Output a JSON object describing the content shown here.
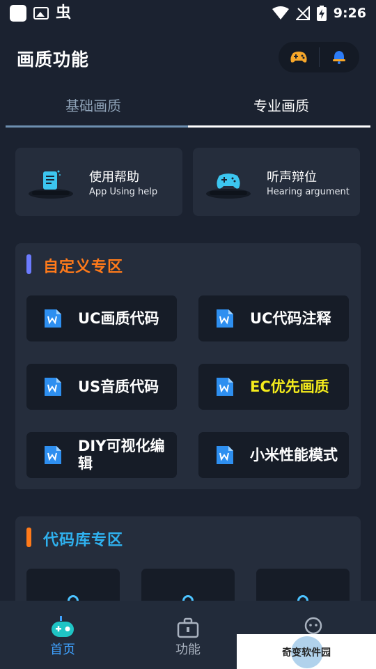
{
  "status_bar": {
    "time": "9:26",
    "bug_glyph": "虫"
  },
  "header": {
    "title": "画质功能",
    "actions": [
      "gamepad-icon",
      "bell-icon"
    ]
  },
  "tabs": [
    {
      "label": "基础画质",
      "active": false
    },
    {
      "label": "专业画质",
      "active": true
    }
  ],
  "help_cards": [
    {
      "title": "使用帮助",
      "subtitle": "App Using help",
      "icon": "document-icon"
    },
    {
      "title": "听声辩位",
      "subtitle": "Hearing argument",
      "icon": "gamepad-icon"
    }
  ],
  "custom_section": {
    "title": "自定义专区",
    "accent": "#6c7bff",
    "title_color": "#ff7a1a",
    "items": [
      {
        "label": "UC画质代码",
        "color": "#ffffff"
      },
      {
        "label": "UC代码注释",
        "color": "#ffffff"
      },
      {
        "label": "US音质代码",
        "color": "#ffffff"
      },
      {
        "label": "EC优先画质",
        "color": "#f5ec1c"
      },
      {
        "label": "DIY可视化编辑",
        "color": "#ffffff"
      },
      {
        "label": "小米性能模式",
        "color": "#ffffff"
      }
    ]
  },
  "code_section": {
    "title": "代码库专区",
    "accent": "#ff7a1a",
    "title_color": "#2fb2f0"
  },
  "bottom_nav": [
    {
      "label": "首页",
      "icon": "robot-icon",
      "active": true
    },
    {
      "label": "功能",
      "icon": "toolbox-icon",
      "active": false
    },
    {
      "label": "",
      "icon": "user-icon",
      "active": false
    }
  ],
  "watermark": {
    "text": "奇变软件园"
  }
}
